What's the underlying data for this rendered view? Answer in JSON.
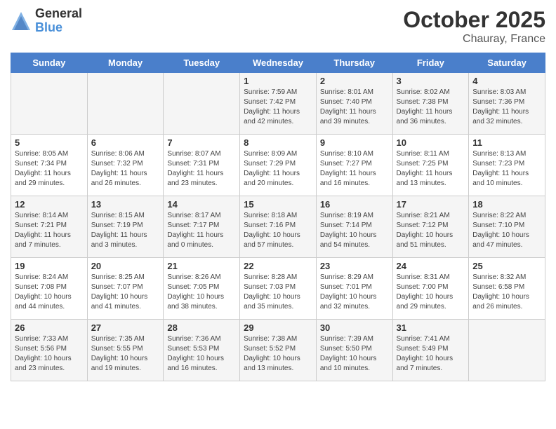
{
  "logo": {
    "general": "General",
    "blue": "Blue"
  },
  "header": {
    "month": "October 2025",
    "location": "Chauray, France"
  },
  "days_of_week": [
    "Sunday",
    "Monday",
    "Tuesday",
    "Wednesday",
    "Thursday",
    "Friday",
    "Saturday"
  ],
  "weeks": [
    [
      {
        "day": "",
        "content": ""
      },
      {
        "day": "",
        "content": ""
      },
      {
        "day": "",
        "content": ""
      },
      {
        "day": "1",
        "content": "Sunrise: 7:59 AM\nSunset: 7:42 PM\nDaylight: 11 hours\nand 42 minutes."
      },
      {
        "day": "2",
        "content": "Sunrise: 8:01 AM\nSunset: 7:40 PM\nDaylight: 11 hours\nand 39 minutes."
      },
      {
        "day": "3",
        "content": "Sunrise: 8:02 AM\nSunset: 7:38 PM\nDaylight: 11 hours\nand 36 minutes."
      },
      {
        "day": "4",
        "content": "Sunrise: 8:03 AM\nSunset: 7:36 PM\nDaylight: 11 hours\nand 32 minutes."
      }
    ],
    [
      {
        "day": "5",
        "content": "Sunrise: 8:05 AM\nSunset: 7:34 PM\nDaylight: 11 hours\nand 29 minutes."
      },
      {
        "day": "6",
        "content": "Sunrise: 8:06 AM\nSunset: 7:32 PM\nDaylight: 11 hours\nand 26 minutes."
      },
      {
        "day": "7",
        "content": "Sunrise: 8:07 AM\nSunset: 7:31 PM\nDaylight: 11 hours\nand 23 minutes."
      },
      {
        "day": "8",
        "content": "Sunrise: 8:09 AM\nSunset: 7:29 PM\nDaylight: 11 hours\nand 20 minutes."
      },
      {
        "day": "9",
        "content": "Sunrise: 8:10 AM\nSunset: 7:27 PM\nDaylight: 11 hours\nand 16 minutes."
      },
      {
        "day": "10",
        "content": "Sunrise: 8:11 AM\nSunset: 7:25 PM\nDaylight: 11 hours\nand 13 minutes."
      },
      {
        "day": "11",
        "content": "Sunrise: 8:13 AM\nSunset: 7:23 PM\nDaylight: 11 hours\nand 10 minutes."
      }
    ],
    [
      {
        "day": "12",
        "content": "Sunrise: 8:14 AM\nSunset: 7:21 PM\nDaylight: 11 hours\nand 7 minutes."
      },
      {
        "day": "13",
        "content": "Sunrise: 8:15 AM\nSunset: 7:19 PM\nDaylight: 11 hours\nand 3 minutes."
      },
      {
        "day": "14",
        "content": "Sunrise: 8:17 AM\nSunset: 7:17 PM\nDaylight: 11 hours\nand 0 minutes."
      },
      {
        "day": "15",
        "content": "Sunrise: 8:18 AM\nSunset: 7:16 PM\nDaylight: 10 hours\nand 57 minutes."
      },
      {
        "day": "16",
        "content": "Sunrise: 8:19 AM\nSunset: 7:14 PM\nDaylight: 10 hours\nand 54 minutes."
      },
      {
        "day": "17",
        "content": "Sunrise: 8:21 AM\nSunset: 7:12 PM\nDaylight: 10 hours\nand 51 minutes."
      },
      {
        "day": "18",
        "content": "Sunrise: 8:22 AM\nSunset: 7:10 PM\nDaylight: 10 hours\nand 47 minutes."
      }
    ],
    [
      {
        "day": "19",
        "content": "Sunrise: 8:24 AM\nSunset: 7:08 PM\nDaylight: 10 hours\nand 44 minutes."
      },
      {
        "day": "20",
        "content": "Sunrise: 8:25 AM\nSunset: 7:07 PM\nDaylight: 10 hours\nand 41 minutes."
      },
      {
        "day": "21",
        "content": "Sunrise: 8:26 AM\nSunset: 7:05 PM\nDaylight: 10 hours\nand 38 minutes."
      },
      {
        "day": "22",
        "content": "Sunrise: 8:28 AM\nSunset: 7:03 PM\nDaylight: 10 hours\nand 35 minutes."
      },
      {
        "day": "23",
        "content": "Sunrise: 8:29 AM\nSunset: 7:01 PM\nDaylight: 10 hours\nand 32 minutes."
      },
      {
        "day": "24",
        "content": "Sunrise: 8:31 AM\nSunset: 7:00 PM\nDaylight: 10 hours\nand 29 minutes."
      },
      {
        "day": "25",
        "content": "Sunrise: 8:32 AM\nSunset: 6:58 PM\nDaylight: 10 hours\nand 26 minutes."
      }
    ],
    [
      {
        "day": "26",
        "content": "Sunrise: 7:33 AM\nSunset: 5:56 PM\nDaylight: 10 hours\nand 23 minutes."
      },
      {
        "day": "27",
        "content": "Sunrise: 7:35 AM\nSunset: 5:55 PM\nDaylight: 10 hours\nand 19 minutes."
      },
      {
        "day": "28",
        "content": "Sunrise: 7:36 AM\nSunset: 5:53 PM\nDaylight: 10 hours\nand 16 minutes."
      },
      {
        "day": "29",
        "content": "Sunrise: 7:38 AM\nSunset: 5:52 PM\nDaylight: 10 hours\nand 13 minutes."
      },
      {
        "day": "30",
        "content": "Sunrise: 7:39 AM\nSunset: 5:50 PM\nDaylight: 10 hours\nand 10 minutes."
      },
      {
        "day": "31",
        "content": "Sunrise: 7:41 AM\nSunset: 5:49 PM\nDaylight: 10 hours\nand 7 minutes."
      },
      {
        "day": "",
        "content": ""
      }
    ]
  ]
}
